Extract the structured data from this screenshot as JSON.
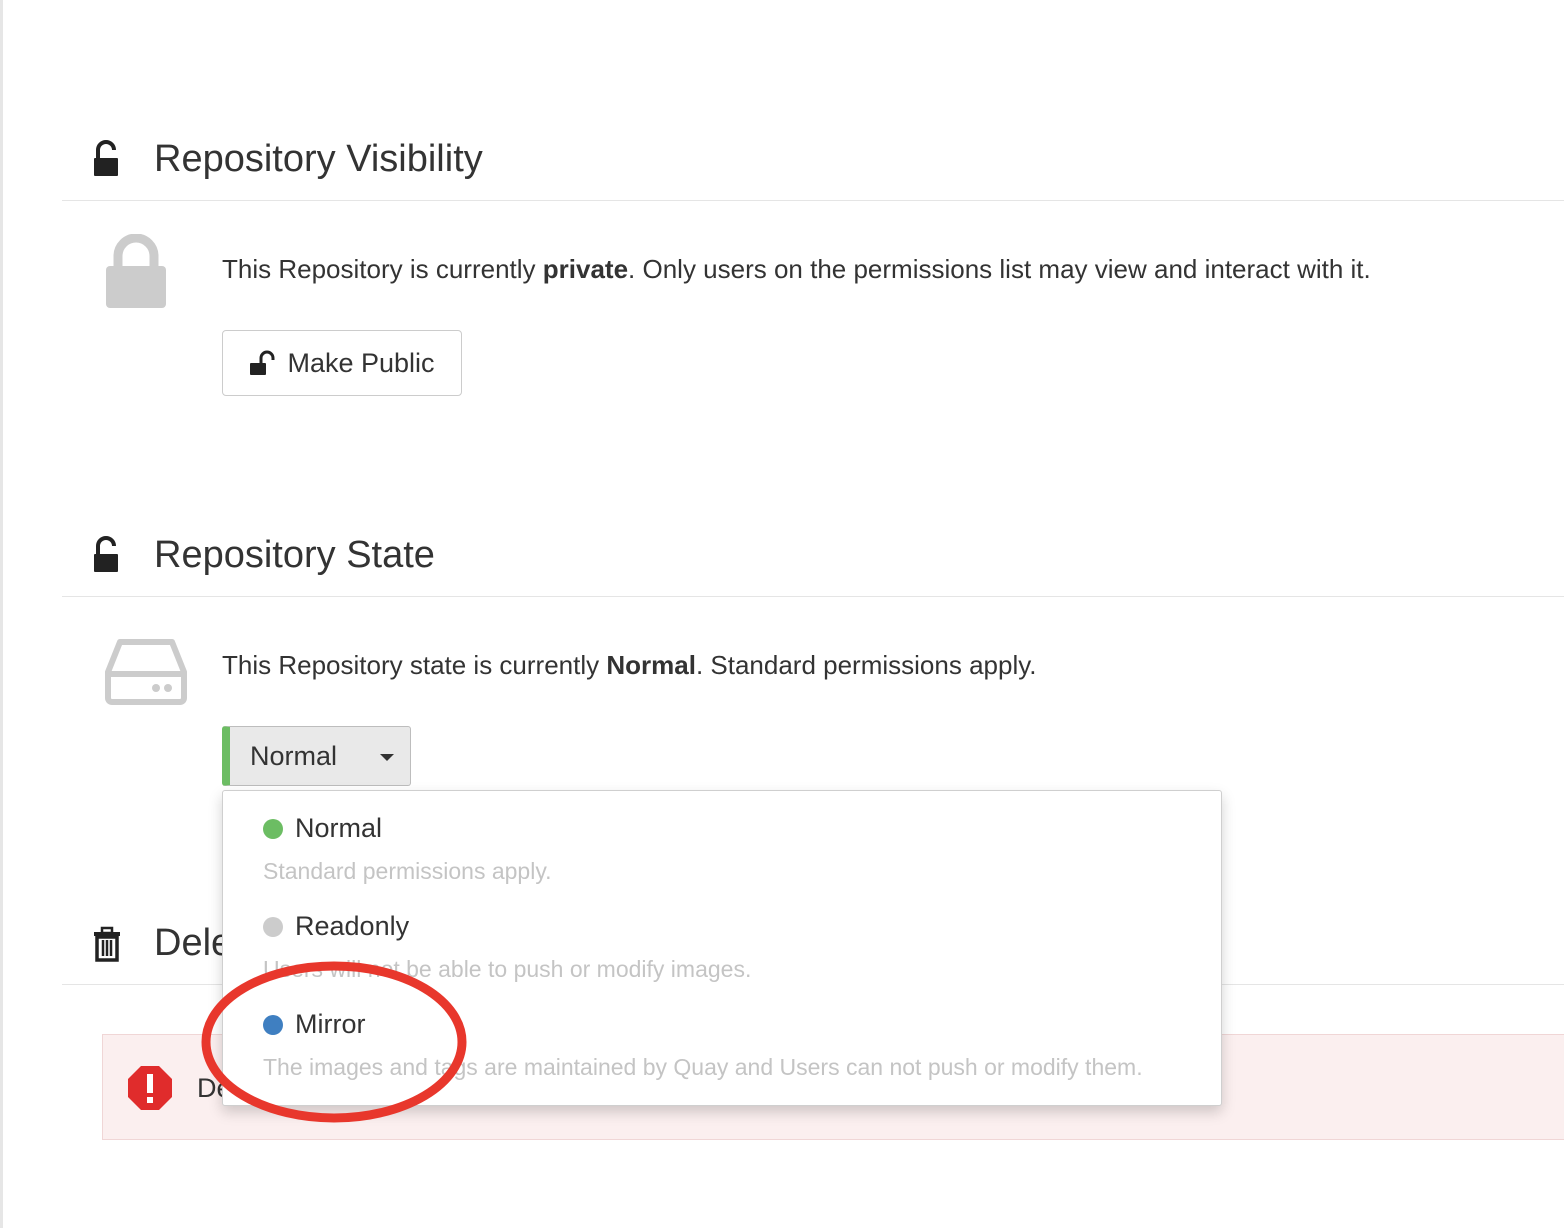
{
  "visibility": {
    "heading": "Repository Visibility",
    "desc_prefix": "This Repository is currently ",
    "desc_bold": "private",
    "desc_suffix": ". Only users on the permissions list may view and interact with it.",
    "make_public_label": "Make Public"
  },
  "state": {
    "heading": "Repository State",
    "desc_prefix": "This Repository state is currently ",
    "desc_bold": "Normal",
    "desc_suffix": ". Standard permissions apply.",
    "selected": "Normal",
    "options": [
      {
        "label": "Normal",
        "desc": "Standard permissions apply.",
        "color": "#6cbd63"
      },
      {
        "label": "Readonly",
        "desc": "Users will not be able to push or modify images.",
        "color": "#cccccc"
      },
      {
        "label": "Mirror",
        "desc": "The images and tags are maintained by Quay and Users can not push or modify them.",
        "color": "#3f7fc1"
      }
    ]
  },
  "delete": {
    "heading": "Dele",
    "alert_text": "De"
  },
  "colors": {
    "accent_green": "#6cbd63",
    "highlight_red": "#e8372c",
    "alert_red": "#e02c2c"
  }
}
